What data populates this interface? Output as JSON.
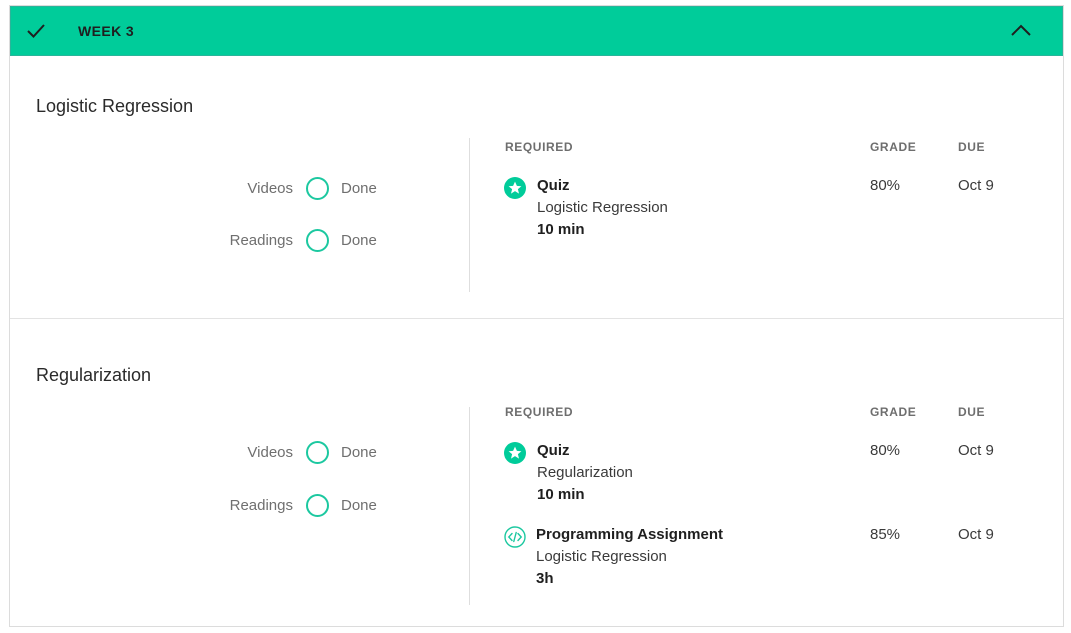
{
  "week": {
    "title": "WEEK 3",
    "icons": {
      "completed": "checkmark-icon",
      "collapse": "chevron-up-icon"
    }
  },
  "columns": {
    "required": "REQUIRED",
    "grade": "GRADE",
    "due": "DUE"
  },
  "lessons": [
    {
      "title": "Logistic Regression",
      "progress": [
        {
          "label": "Videos",
          "status": "Done"
        },
        {
          "label": "Readings",
          "status": "Done"
        }
      ],
      "items": [
        {
          "icon": "star-badge-icon",
          "type": "Quiz",
          "name": "Logistic Regression",
          "duration": "10 min",
          "grade": "80%",
          "due": "Oct 9"
        }
      ]
    },
    {
      "title": "Regularization",
      "progress": [
        {
          "label": "Videos",
          "status": "Done"
        },
        {
          "label": "Readings",
          "status": "Done"
        }
      ],
      "items": [
        {
          "icon": "star-badge-icon",
          "type": "Quiz",
          "name": "Regularization",
          "duration": "10 min",
          "grade": "80%",
          "due": "Oct 9"
        },
        {
          "icon": "code-icon",
          "type": "Programming Assignment",
          "name": "Logistic Regression",
          "duration": "3h",
          "grade": "85%",
          "due": "Oct 9"
        }
      ]
    }
  ],
  "colors": {
    "accent": "#00cc9a",
    "ring": "#1cc8a0"
  }
}
